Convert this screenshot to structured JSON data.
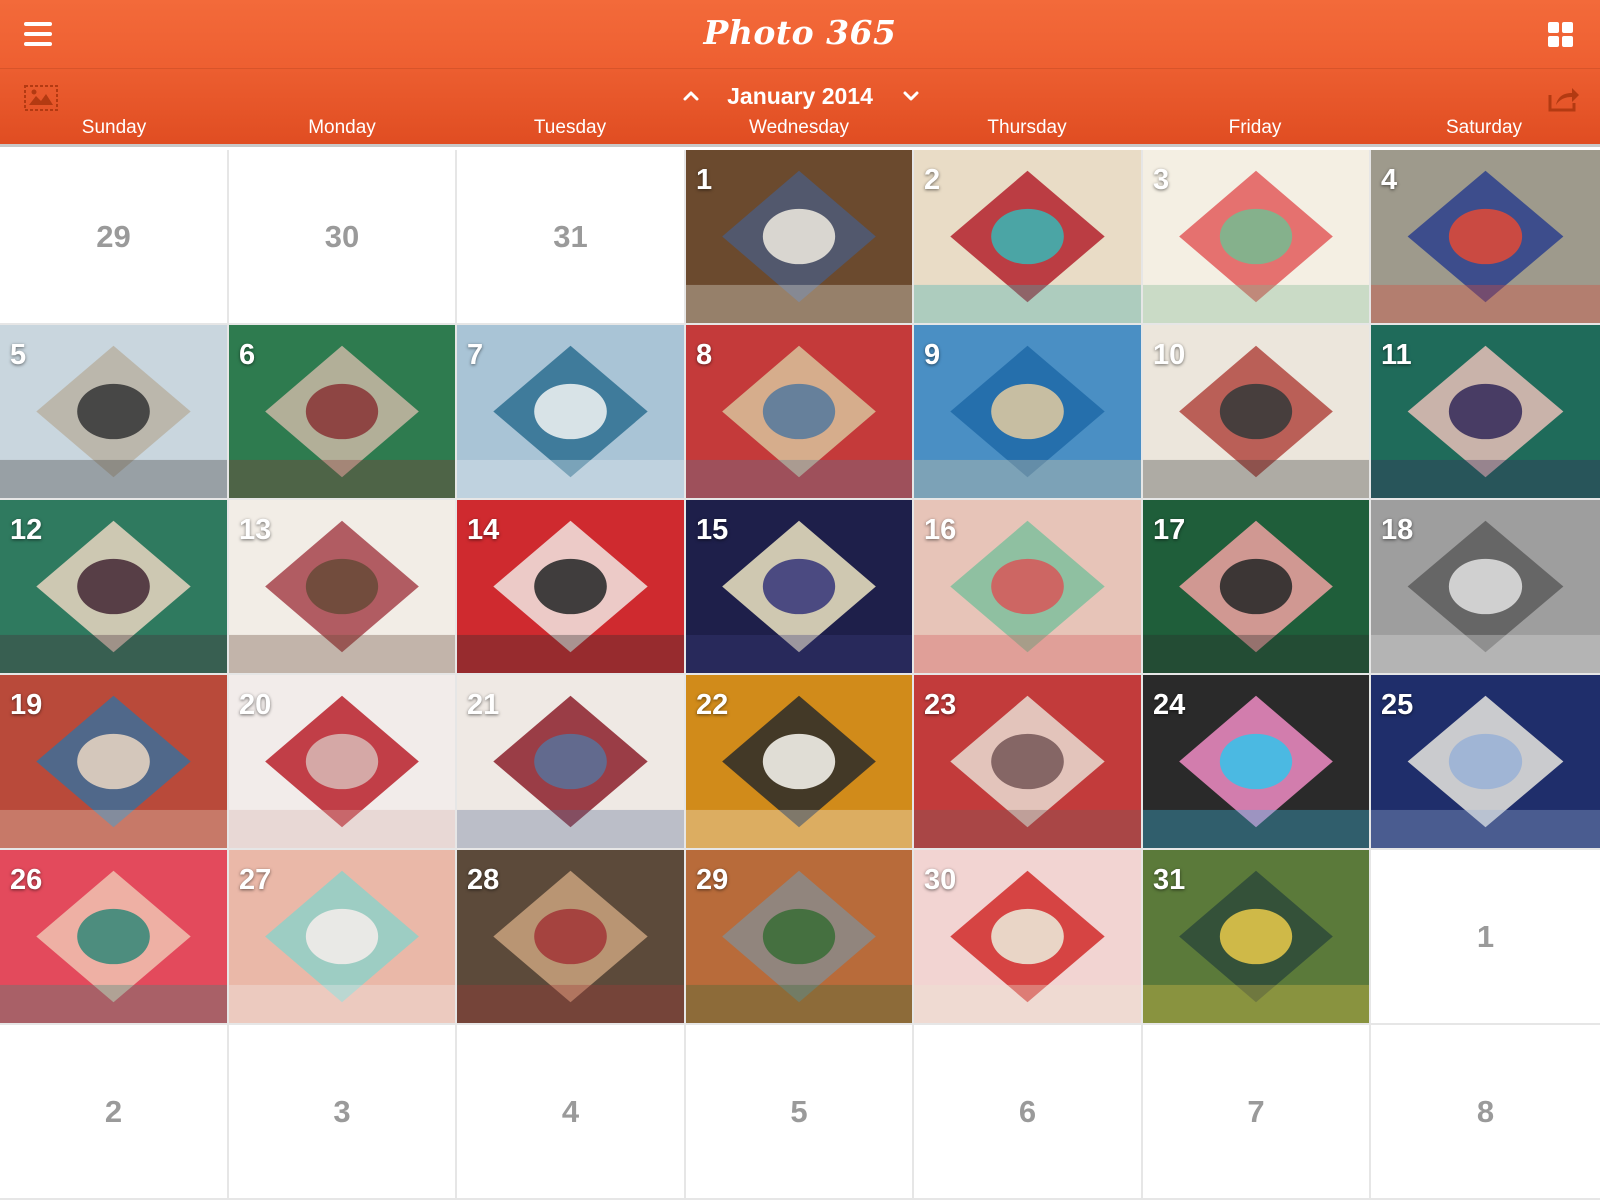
{
  "app": {
    "title": "Photo 365"
  },
  "header": {
    "menu_icon": "hamburger-menu-icon",
    "grid_icon": "grid-view-icon",
    "photo_icon": "photo-frame-icon",
    "share_icon": "share-icon",
    "month_label": "January 2014",
    "prev_icon": "chevron-up-icon",
    "next_icon": "chevron-down-icon"
  },
  "weekdays": [
    "Sunday",
    "Monday",
    "Tuesday",
    "Wednesday",
    "Thursday",
    "Friday",
    "Saturday"
  ],
  "colors": {
    "header": "#f26636",
    "subheader": "#e55426",
    "gridline": "#e6e6e6",
    "muted_day": "#9a9a9a"
  },
  "days": [
    {
      "label": "29",
      "photo": false
    },
    {
      "label": "30",
      "photo": false
    },
    {
      "label": "31",
      "photo": false
    },
    {
      "label": "1",
      "photo": true,
      "colors": [
        "#6b4a2e",
        "#4d5a78",
        "#e8e4da"
      ]
    },
    {
      "label": "2",
      "photo": true,
      "colors": [
        "#e9dcc6",
        "#b3212b",
        "#3fb0b0"
      ]
    },
    {
      "label": "3",
      "photo": true,
      "colors": [
        "#f4efe3",
        "#e25a5a",
        "#7ab88f"
      ]
    },
    {
      "label": "4",
      "photo": true,
      "colors": [
        "#9e9a8c",
        "#2c3f8c",
        "#d94a3a"
      ]
    },
    {
      "label": "5",
      "photo": true,
      "colors": [
        "#c9d6de",
        "#b8b2a3",
        "#3b3b3b"
      ]
    },
    {
      "label": "6",
      "photo": true,
      "colors": [
        "#2e7b4f",
        "#c9b8a5",
        "#8a3a3a"
      ]
    },
    {
      "label": "7",
      "photo": true,
      "colors": [
        "#a9c4d6",
        "#2d6f90",
        "#e9eef0"
      ]
    },
    {
      "label": "8",
      "photo": true,
      "colors": [
        "#c43a3a",
        "#d9c29b",
        "#5a7b9c"
      ]
    },
    {
      "label": "9",
      "photo": true,
      "colors": [
        "#4a8fc4",
        "#1f6aa8",
        "#d9c6a1"
      ]
    },
    {
      "label": "10",
      "photo": true,
      "colors": [
        "#ece6dc",
        "#b2463f",
        "#3b3b3b"
      ]
    },
    {
      "label": "11",
      "photo": true,
      "colors": [
        "#1f6b5a",
        "#e8c0b8",
        "#3a2f5c"
      ]
    },
    {
      "label": "12",
      "photo": true,
      "colors": [
        "#2f7a5f",
        "#e9d6c1",
        "#4a2f3a"
      ]
    },
    {
      "label": "13",
      "photo": true,
      "colors": [
        "#f2ede6",
        "#a6424a",
        "#6b4a3a"
      ]
    },
    {
      "label": "14",
      "photo": true,
      "colors": [
        "#cf2a2f",
        "#f1e6e2",
        "#2e2e2e"
      ]
    },
    {
      "label": "15",
      "photo": true,
      "colors": [
        "#1e1f4a",
        "#efe6c3",
        "#3c3c7c"
      ]
    },
    {
      "label": "16",
      "photo": true,
      "colors": [
        "#e7c4b8",
        "#7fbf9c",
        "#d45c5c"
      ]
    },
    {
      "label": "17",
      "photo": true,
      "colors": [
        "#1f5e3a",
        "#f0a2a2",
        "#2b2b2b"
      ]
    },
    {
      "label": "18",
      "photo": true,
      "colors": [
        "#9e9e9e",
        "#5c5c5c",
        "#dcdcdc"
      ]
    },
    {
      "label": "19",
      "photo": true,
      "colors": [
        "#b94a3a",
        "#3d6d99",
        "#e2d2c0"
      ]
    },
    {
      "label": "20",
      "photo": true,
      "colors": [
        "#f2ecea",
        "#b8202a",
        "#d7b4b0"
      ]
    },
    {
      "label": "21",
      "photo": true,
      "colors": [
        "#efe9e4",
        "#8b1f2a",
        "#5c6f96"
      ]
    },
    {
      "label": "22",
      "photo": true,
      "colors": [
        "#d18b1a",
        "#2a2a2a",
        "#f2efe9"
      ]
    },
    {
      "label": "23",
      "photo": true,
      "colors": [
        "#c23b3b",
        "#e9ddd2",
        "#7a5c5c"
      ]
    },
    {
      "label": "24",
      "photo": true,
      "colors": [
        "#2a2a2a",
        "#f08cc4",
        "#3cc0e8"
      ]
    },
    {
      "label": "25",
      "photo": true,
      "colors": [
        "#1f2e6b",
        "#e9e6df",
        "#9bb2d6"
      ]
    },
    {
      "label": "26",
      "photo": true,
      "colors": [
        "#e34a5c",
        "#f0c2b0",
        "#3b8a7a"
      ]
    },
    {
      "label": "27",
      "photo": true,
      "colors": [
        "#eab8a8",
        "#8fd0c8",
        "#f2ecea"
      ]
    },
    {
      "label": "28",
      "photo": true,
      "colors": [
        "#5c4a3a",
        "#c9a27e",
        "#a33a3a"
      ]
    },
    {
      "label": "29",
      "photo": true,
      "colors": [
        "#b86b3a",
        "#8a8a8a",
        "#3d6e3a"
      ]
    },
    {
      "label": "30",
      "photo": true,
      "colors": [
        "#f2d4d2",
        "#d12a2a",
        "#ebe5d5"
      ]
    },
    {
      "label": "31",
      "photo": true,
      "colors": [
        "#5b7a3a",
        "#2e4a3a",
        "#e0c44a"
      ]
    },
    {
      "label": "1",
      "photo": false
    },
    {
      "label": "2",
      "photo": false
    },
    {
      "label": "3",
      "photo": false
    },
    {
      "label": "4",
      "photo": false
    },
    {
      "label": "5",
      "photo": false
    },
    {
      "label": "6",
      "photo": false
    },
    {
      "label": "7",
      "photo": false
    },
    {
      "label": "8",
      "photo": false
    }
  ]
}
